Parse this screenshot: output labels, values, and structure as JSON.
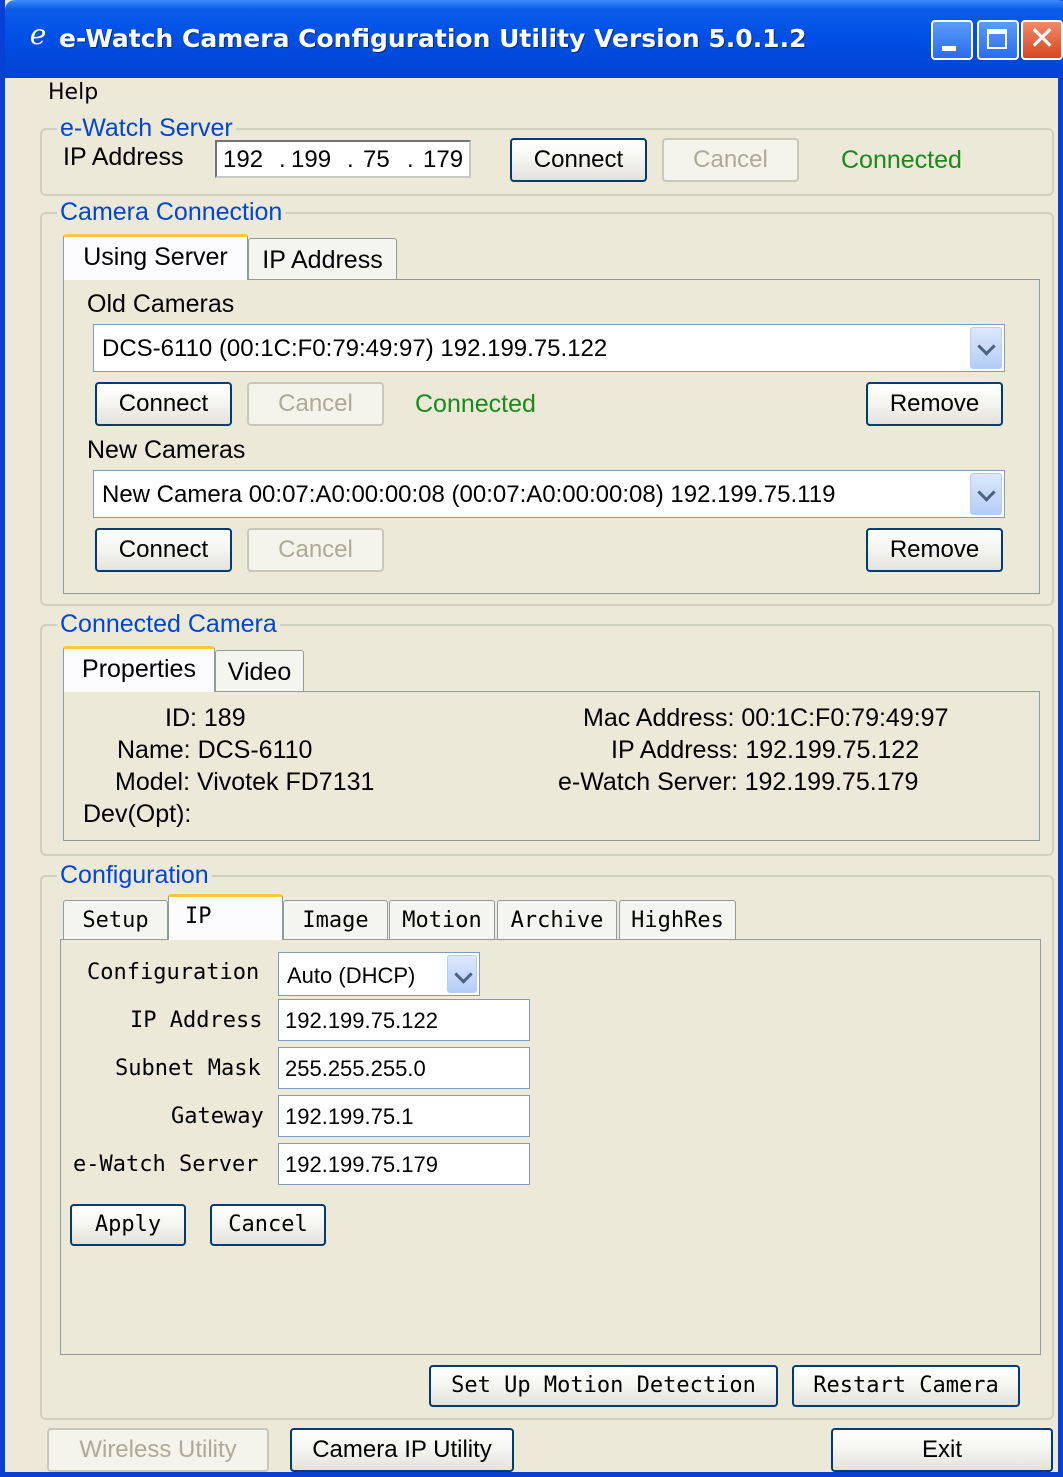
{
  "window": {
    "title": "e-Watch Camera Configuration Utility Version 5.0.1.2",
    "icon": "ewatch-logo-icon"
  },
  "menu": {
    "help": "Help"
  },
  "server": {
    "legend": "e-Watch Server",
    "ip_label": "IP Address",
    "ip_octets": [
      "192",
      "199",
      "75",
      "179"
    ],
    "connect": "Connect",
    "cancel": "Cancel",
    "status": "Connected"
  },
  "camera_connection": {
    "legend": "Camera Connection",
    "tabs": [
      "Using Server",
      "IP Address"
    ],
    "old_label": "Old Cameras",
    "old_selected": "DCS-6110 (00:1C:F0:79:49:97) 192.199.75.122",
    "old_connect": "Connect",
    "old_cancel": "Cancel",
    "old_status": "Connected",
    "old_remove": "Remove",
    "new_label": "New Cameras",
    "new_selected": "New Camera 00:07:A0:00:00:08 (00:07:A0:00:00:08) 192.199.75.119",
    "new_connect": "Connect",
    "new_cancel": "Cancel",
    "new_remove": "Remove"
  },
  "connected_camera": {
    "legend": "Connected Camera",
    "tabs": [
      "Properties",
      "Video"
    ],
    "id": "ID: 189",
    "name": "Name: DCS-6110",
    "model": "Model: Vivotek FD7131",
    "dev": "Dev(Opt):",
    "mac": "Mac Address: 00:1C:F0:79:49:97",
    "ip": "IP Address: 192.199.75.122",
    "server": "e-Watch Server: 192.199.75.179"
  },
  "configuration": {
    "legend": "Configuration",
    "tabs": [
      "Setup",
      "IP",
      "Image",
      "Motion",
      "Archive",
      "HighRes"
    ],
    "config_label": "Configuration",
    "config_value": "Auto (DHCP)",
    "ip_label": "IP Address",
    "ip_value": "192.199.75.122",
    "subnet_label": "Subnet Mask",
    "subnet_value": "255.255.255.0",
    "gateway_label": "Gateway",
    "gateway_value": "192.199.75.1",
    "server_label": "e-Watch Server",
    "server_value": "192.199.75.179",
    "apply": "Apply",
    "cancel": "Cancel",
    "motion_btn": "Set Up Motion Detection",
    "restart_btn": "Restart Camera"
  },
  "footer": {
    "wireless": "Wireless Utility",
    "camera_ip": "Camera IP Utility",
    "exit": "Exit"
  }
}
